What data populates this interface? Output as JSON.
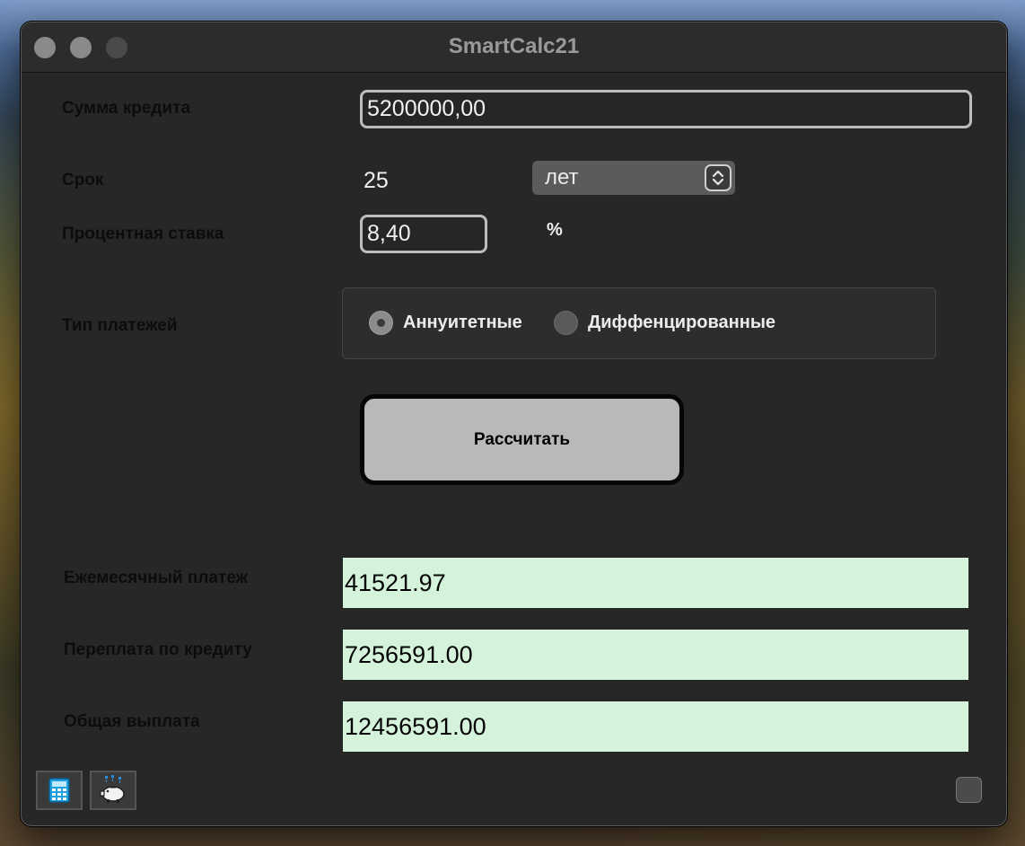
{
  "window": {
    "title": "SmartCalc21"
  },
  "form": {
    "amount_label": "Сумма кредита",
    "amount_value": "5200000,00",
    "term_label": "Срок",
    "term_value": "25",
    "term_unit": "лет",
    "rate_label": "Процентная ставка",
    "rate_value": "8,40",
    "rate_unit": "%",
    "payment_type_label": "Тип платежей",
    "payment_types": [
      {
        "label": "Аннуитетные",
        "selected": true
      },
      {
        "label": "Диффенцированные",
        "selected": false
      }
    ],
    "calculate_label": "Рассчитать"
  },
  "results": {
    "monthly_label": "Ежемесячный платеж",
    "monthly_value": "41521.97",
    "overpay_label": "Переплата по кредиту",
    "overpay_value": "7256591.00",
    "total_label": "Общая выплата",
    "total_value": "12456591.00"
  },
  "toolbar": {
    "buttons": [
      {
        "icon": "calculator-icon"
      },
      {
        "icon": "piggy-bank-icon"
      }
    ]
  },
  "colors": {
    "window_bg": "#272727",
    "result_bg": "#d5f2db",
    "button_bg": "#b9b9b9"
  }
}
